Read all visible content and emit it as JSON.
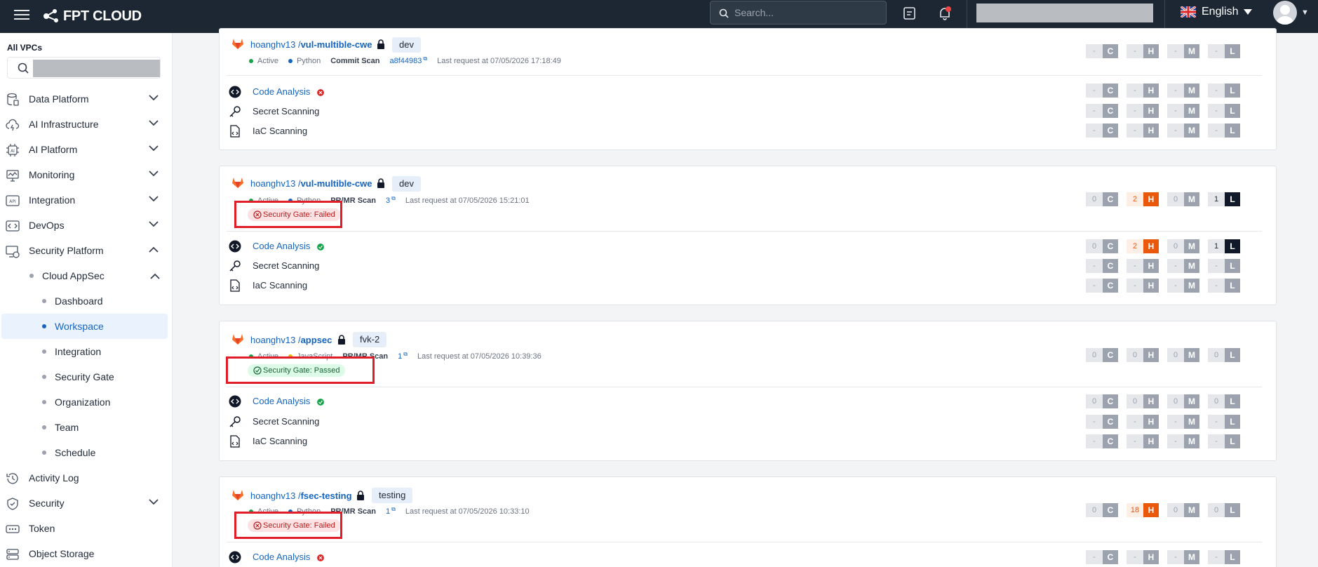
{
  "topbar": {
    "logo_text": "FPT CLOUD",
    "search_placeholder": "Search...",
    "language": "English"
  },
  "sidebar": {
    "vpc_label": "All VPCs",
    "items": [
      {
        "label": "Data Platform",
        "icon": "database-icon"
      },
      {
        "label": "AI Infrastructure",
        "icon": "cloud-bolt-icon"
      },
      {
        "label": "AI Platform",
        "icon": "ai-chip-icon"
      },
      {
        "label": "Monitoring",
        "icon": "monitor-icon"
      },
      {
        "label": "Integration",
        "icon": "api-icon"
      },
      {
        "label": "DevOps",
        "icon": "devops-icon"
      },
      {
        "label": "Security Platform",
        "icon": "security-platform-icon"
      },
      {
        "label": "Activity Log",
        "icon": "history-icon"
      },
      {
        "label": "Security",
        "icon": "shield-icon"
      },
      {
        "label": "Token",
        "icon": "token-icon"
      },
      {
        "label": "Object Storage",
        "icon": "storage-icon"
      }
    ],
    "cloud_appsec": "Cloud AppSec",
    "subitems": [
      "Dashboard",
      "Workspace",
      "Integration",
      "Security Gate",
      "Organization",
      "Team",
      "Schedule"
    ],
    "active_subitem": "Workspace"
  },
  "scan_names": {
    "code": "Code Analysis",
    "secret": "Secret Scanning",
    "iac": "IaC Scanning"
  },
  "severity_letters": [
    "C",
    "H",
    "M",
    "L"
  ],
  "cards": [
    {
      "owner": "hoanghv13 /",
      "repo": "vul-multible-cwe",
      "branch": "dev",
      "status": "Active",
      "language": "Python",
      "language_color": "#1565c0",
      "scan_type": "Commit Scan",
      "ref": "a8f44983",
      "last_request": "Last request at 07/05/2026 17:18:49",
      "gate": null,
      "summary": [
        "-",
        "-",
        "-",
        "-"
      ],
      "scans": {
        "code": [
          "-",
          "-",
          "-",
          "-"
        ],
        "secret": [
          "-",
          "-",
          "-",
          "-"
        ],
        "iac": [
          "-",
          "-",
          "-",
          "-"
        ]
      },
      "code_status": "failed"
    },
    {
      "owner": "hoanghv13 /",
      "repo": "vul-multible-cwe",
      "branch": "dev",
      "status": "Active",
      "language": "Python",
      "language_color": "#1565c0",
      "scan_type": "PR/MR Scan",
      "ref": "3",
      "last_request": "Last request at 07/05/2026 15:21:01",
      "gate": "Security Gate: Failed",
      "gate_state": "failed",
      "summary": [
        "0",
        "2",
        "0",
        "1"
      ],
      "scans": {
        "code": [
          "0",
          "2",
          "0",
          "1"
        ],
        "secret": [
          "-",
          "-",
          "-",
          "-"
        ],
        "iac": [
          "-",
          "-",
          "-",
          "-"
        ]
      },
      "code_status": "passed"
    },
    {
      "owner": "hoanghv13 /",
      "repo": "appsec",
      "branch": "fvk-2",
      "status": "Active",
      "language": "JavaScript",
      "language_color": "#eab308",
      "scan_type": "PR/MR Scan",
      "ref": "1",
      "last_request": "Last request at 07/05/2026 10:39:36",
      "gate": "Security Gate: Passed",
      "gate_state": "passed",
      "summary": [
        "0",
        "0",
        "0",
        "0"
      ],
      "scans": {
        "code": [
          "0",
          "0",
          "0",
          "0"
        ],
        "secret": [
          "-",
          "-",
          "-",
          "-"
        ],
        "iac": [
          "-",
          "-",
          "-",
          "-"
        ]
      },
      "code_status": "passed"
    },
    {
      "owner": "hoanghv13 /",
      "repo": "fsec-testing",
      "branch": "testing",
      "status": "Active",
      "language": "Python",
      "language_color": "#1565c0",
      "scan_type": "PR/MR Scan",
      "ref": "1",
      "last_request": "Last request at 07/05/2026 10:33:10",
      "gate": "Security Gate: Failed",
      "gate_state": "failed",
      "summary": [
        "0",
        "18",
        "0",
        "0"
      ],
      "scans": {
        "code": [
          "-",
          "-",
          "-",
          "-"
        ]
      },
      "code_status": "failed"
    }
  ],
  "colors": {
    "accent": "#1565c0",
    "high": "#ea580c",
    "fail_red": "#e11d2a",
    "topbar": "#1d2733"
  }
}
